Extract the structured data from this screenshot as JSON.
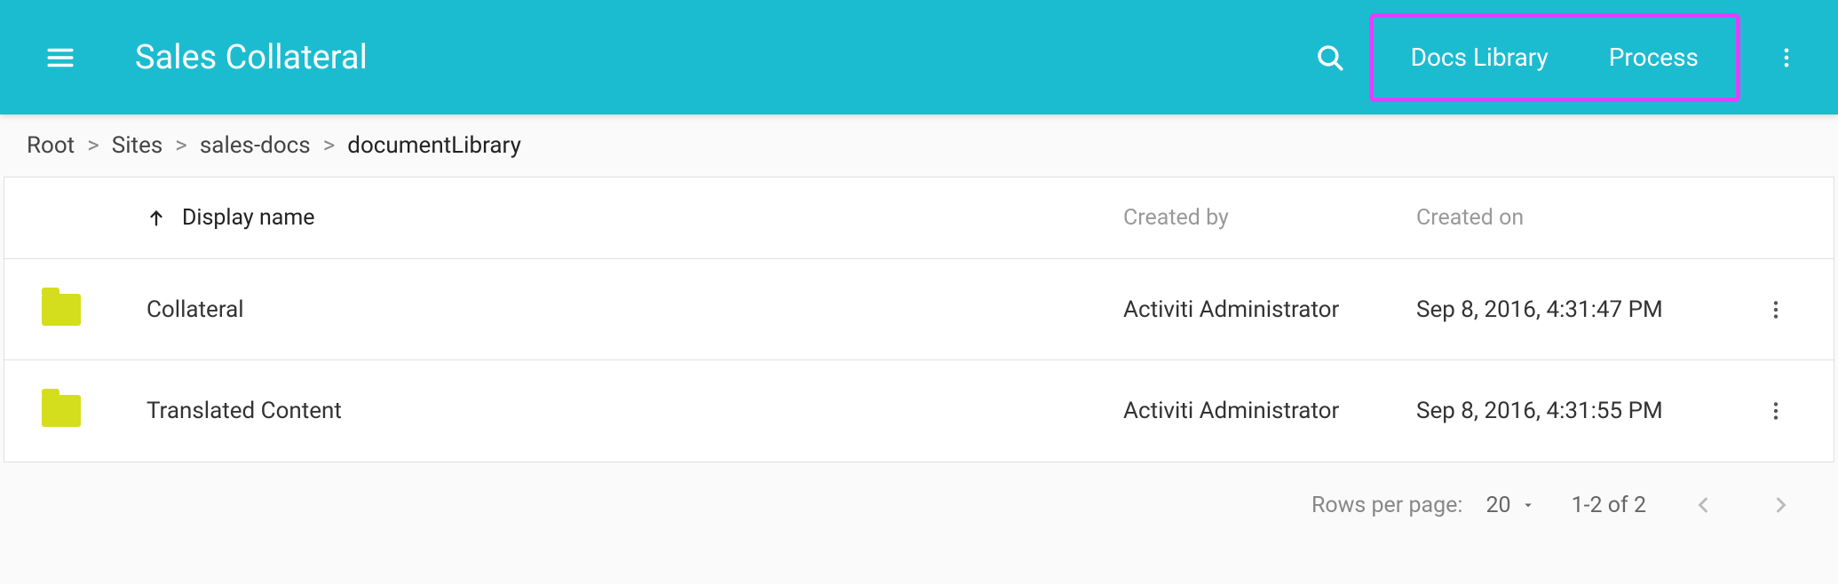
{
  "header": {
    "title": "Sales Collateral",
    "tabs": [
      {
        "label": "Docs Library"
      },
      {
        "label": "Process"
      }
    ]
  },
  "breadcrumb": {
    "items": [
      {
        "label": "Root"
      },
      {
        "label": "Sites"
      },
      {
        "label": "sales-docs"
      },
      {
        "label": "documentLibrary"
      }
    ]
  },
  "table": {
    "columns": {
      "name": "Display name",
      "created_by": "Created by",
      "created_on": "Created on"
    },
    "rows": [
      {
        "name": "Collateral",
        "created_by": "Activiti Administrator",
        "created_on": "Sep 8, 2016, 4:31:47 PM"
      },
      {
        "name": "Translated Content",
        "created_by": "Activiti Administrator",
        "created_on": "Sep 8, 2016, 4:31:55 PM"
      }
    ]
  },
  "paginator": {
    "rows_per_page_label": "Rows per page:",
    "page_size": "20",
    "range": "1-2 of 2"
  }
}
